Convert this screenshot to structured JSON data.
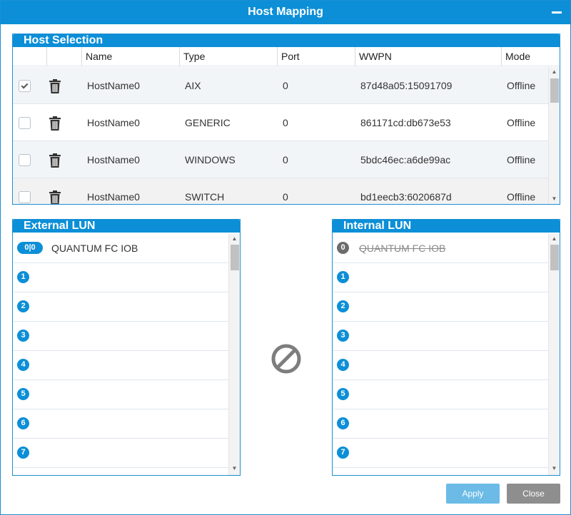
{
  "dialog": {
    "title": "Host Mapping"
  },
  "host_selection": {
    "title": "Host Selection",
    "columns": [
      "Name",
      "Type",
      "Port",
      "WWPN",
      "Mode"
    ],
    "rows": [
      {
        "checked": true,
        "name": "HostName0",
        "type": "AIX",
        "port": "0",
        "wwpn": "87d48a05:15091709",
        "mode": "Offline"
      },
      {
        "checked": false,
        "name": "HostName0",
        "type": "GENERIC",
        "port": "0",
        "wwpn": "861171cd:db673e53",
        "mode": "Offline"
      },
      {
        "checked": false,
        "name": "HostName0",
        "type": "WINDOWS",
        "port": "0",
        "wwpn": "5bdc46ec:a6de99ac",
        "mode": "Offline"
      },
      {
        "checked": false,
        "name": "HostName0",
        "type": "SWITCH",
        "port": "0",
        "wwpn": "bd1eecb3:6020687d",
        "mode": "Offline"
      }
    ]
  },
  "external_lun": {
    "title": "External LUN",
    "first_badge": "0|0",
    "first_name": "QUANTUM FC IOB",
    "numbers": [
      "1",
      "2",
      "3",
      "4",
      "5",
      "6",
      "7"
    ]
  },
  "internal_lun": {
    "title": "Internal LUN",
    "first_badge": "0",
    "first_name": "QUANTUM FC IOB",
    "numbers": [
      "1",
      "2",
      "3",
      "4",
      "5",
      "6",
      "7"
    ]
  },
  "buttons": {
    "apply": "Apply",
    "close": "Close"
  },
  "colors": {
    "accent": "#0c8fd7",
    "apply": "#6bbbe6",
    "close": "#8e8e8e",
    "disabled_badge": "#6c6c6c"
  },
  "icons": {
    "delete": "trash-icon",
    "no_mapping": "no-mapping-icon",
    "minimize": "minimize-icon"
  }
}
